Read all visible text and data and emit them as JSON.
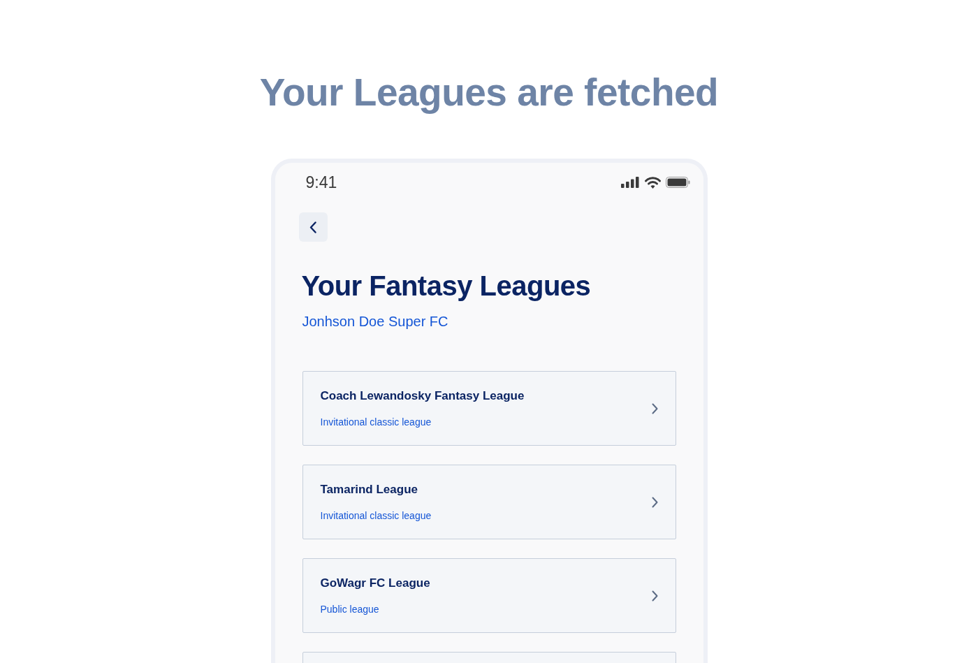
{
  "heading": "Your Leagues are fetched",
  "status_bar": {
    "time": "9:41"
  },
  "screen": {
    "title": "Your Fantasy Leagues",
    "team": "Jonhson Doe Super FC"
  },
  "leagues": [
    {
      "name": "Coach Lewandosky Fantasy League",
      "type": "Invitational classic league"
    },
    {
      "name": "Tamarind League",
      "type": "Invitational classic league"
    },
    {
      "name": "GoWagr FC League",
      "type": "Public league"
    }
  ]
}
